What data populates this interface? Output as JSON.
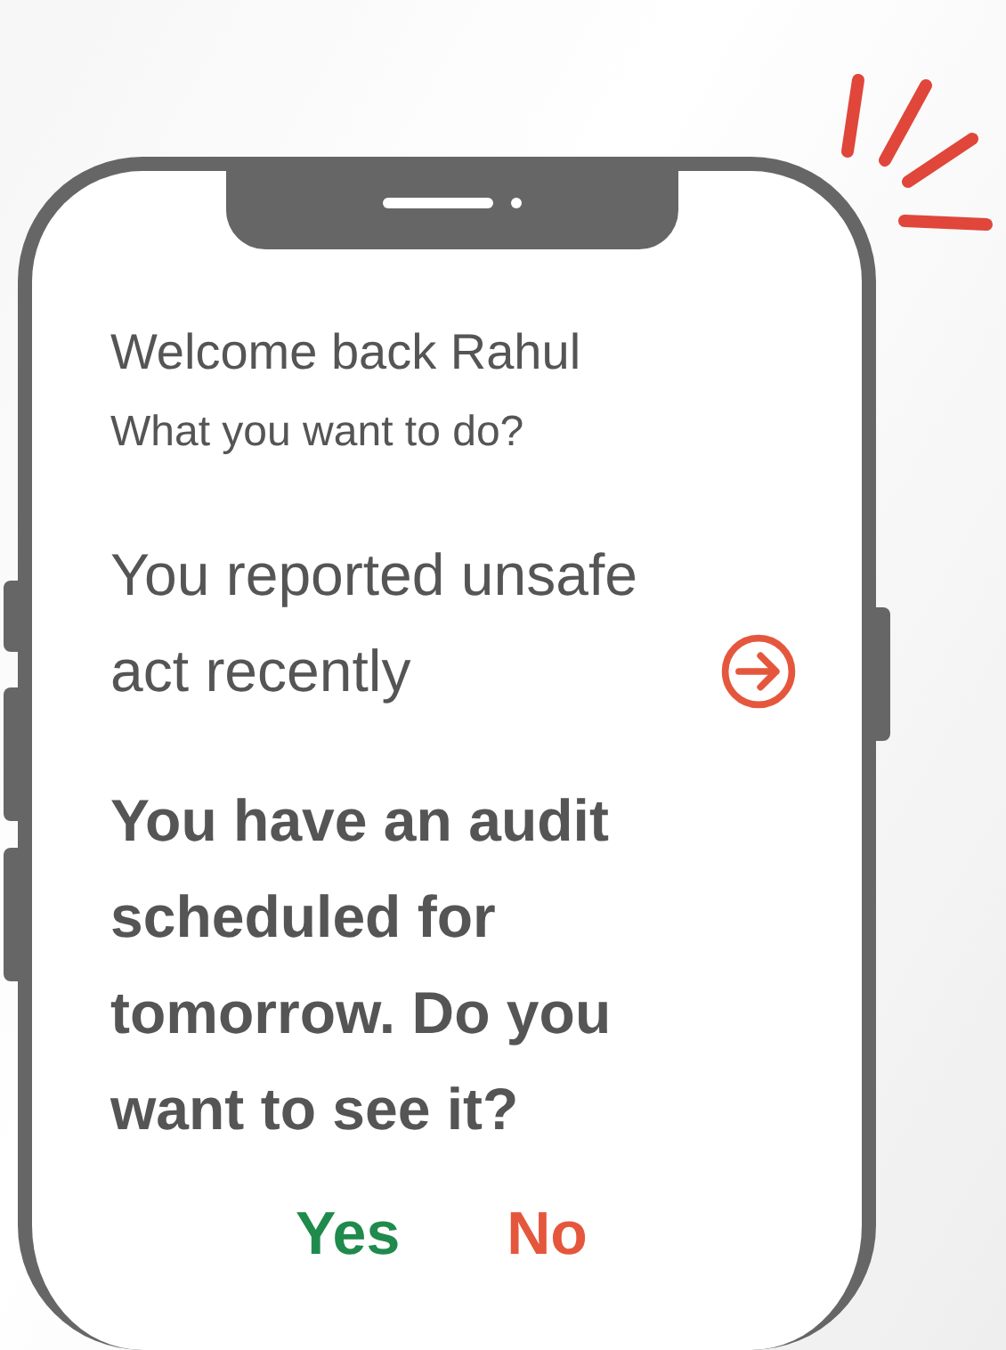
{
  "greeting": "Welcome back Rahul",
  "prompt": "What you want to do?",
  "notice": {
    "text": "You reported unsafe act recently"
  },
  "question": "You have an audit scheduled for tomorrow. Do you want to see it?",
  "answers": [
    {
      "label": "Yes",
      "kind": "yes"
    },
    {
      "label": "No",
      "kind": "no"
    }
  ]
}
